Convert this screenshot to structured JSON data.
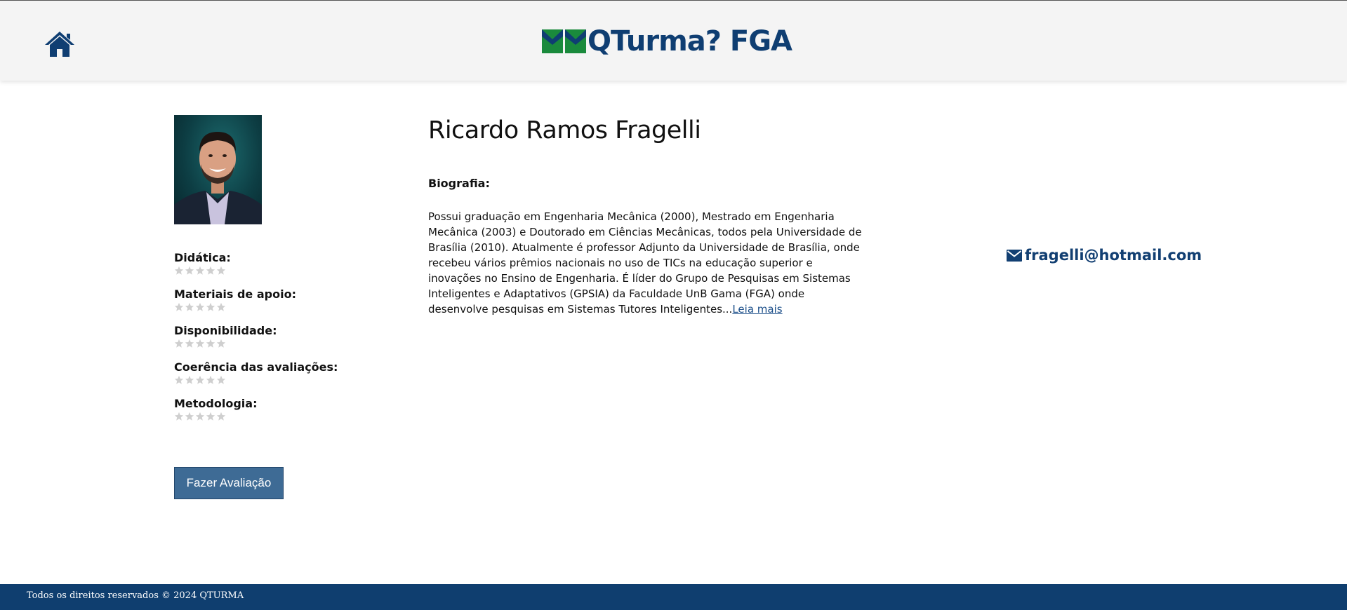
{
  "header": {
    "logo_text": "QTurma? FGA",
    "colors": {
      "brand_blue": "#0f3e72",
      "flag_green": "#1a8a3c"
    }
  },
  "profile": {
    "name": "Ricardo Ramos Fragelli",
    "bio_label": "Biografia:",
    "bio_text": "Possui graduação em Engenharia Mecânica (2000), Mestrado em Engenharia Mecânica (2003) e Doutorado em Ciências Mecânicas, todos pela Universidade de Brasília (2010). Atualmente é professor Adjunto da Universidade de Brasília, onde recebeu vários prêmios nacionais no uso de TICs na educação superior e inovações no Ensino de Engenharia. É líder do Grupo de Pesquisas em Sistemas Inteligentes e Adaptativos (GPSIA) da Faculdade UnB Gama (FGA) onde desenvolve pesquisas em Sistemas Tutores Inteligentes...",
    "read_more": "Leia mais",
    "email": "fragelli@hotmail.com"
  },
  "ratings": [
    {
      "label": "Didática:",
      "stars_filled": 0,
      "stars_total": 5
    },
    {
      "label": "Materiais de apoio:",
      "stars_filled": 0,
      "stars_total": 5
    },
    {
      "label": "Disponibilidade:",
      "stars_filled": 0,
      "stars_total": 5
    },
    {
      "label": "Coerência das avaliações:",
      "stars_filled": 0,
      "stars_total": 5
    },
    {
      "label": "Metodologia:",
      "stars_filled": 0,
      "stars_total": 5
    }
  ],
  "actions": {
    "evaluate_button": "Fazer Avaliação"
  },
  "footer": {
    "text": "Todos os direitos reservados © 2024 QTURMA"
  }
}
